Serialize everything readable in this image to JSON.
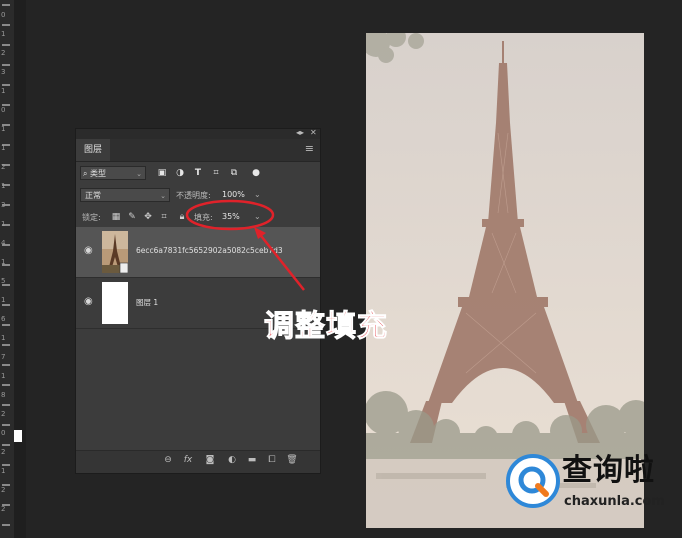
{
  "ruler": {
    "numbers": [
      "0",
      "1",
      "2",
      "3",
      "1",
      "0",
      "1",
      "1",
      "2",
      "1",
      "3",
      "1",
      "4",
      "1",
      "5",
      "1",
      "6",
      "1",
      "7",
      "1",
      "8",
      "2",
      "0",
      "2",
      "1",
      "2",
      "2"
    ]
  },
  "panel": {
    "tab_label": "图层",
    "collapse_glyph": "◂▸",
    "close_glyph": "✕",
    "menu_glyph": "≡",
    "filter": {
      "icon": "search-icon",
      "value": "类型"
    },
    "blend_mode": "正常",
    "opacity_label": "不透明度:",
    "opacity_value": "100%",
    "lock_label": "锁定:",
    "fill_label": "填充:",
    "fill_value": "35%",
    "layers": [
      {
        "name": "6ecc6a7831fc5652902a5082c5ceb7d3",
        "selected": true,
        "visible": true
      },
      {
        "name": "图层 1",
        "selected": false,
        "visible": true
      }
    ],
    "footer": [
      "link-icon",
      "fx-icon",
      "mask-icon",
      "adjustment-icon",
      "folder-icon",
      "new-layer-icon",
      "trash-icon"
    ]
  },
  "annotation": {
    "text": "调整填充",
    "color": "#e0222a"
  },
  "watermark": {
    "title": "查询啦",
    "url": "chaxunla.com"
  }
}
